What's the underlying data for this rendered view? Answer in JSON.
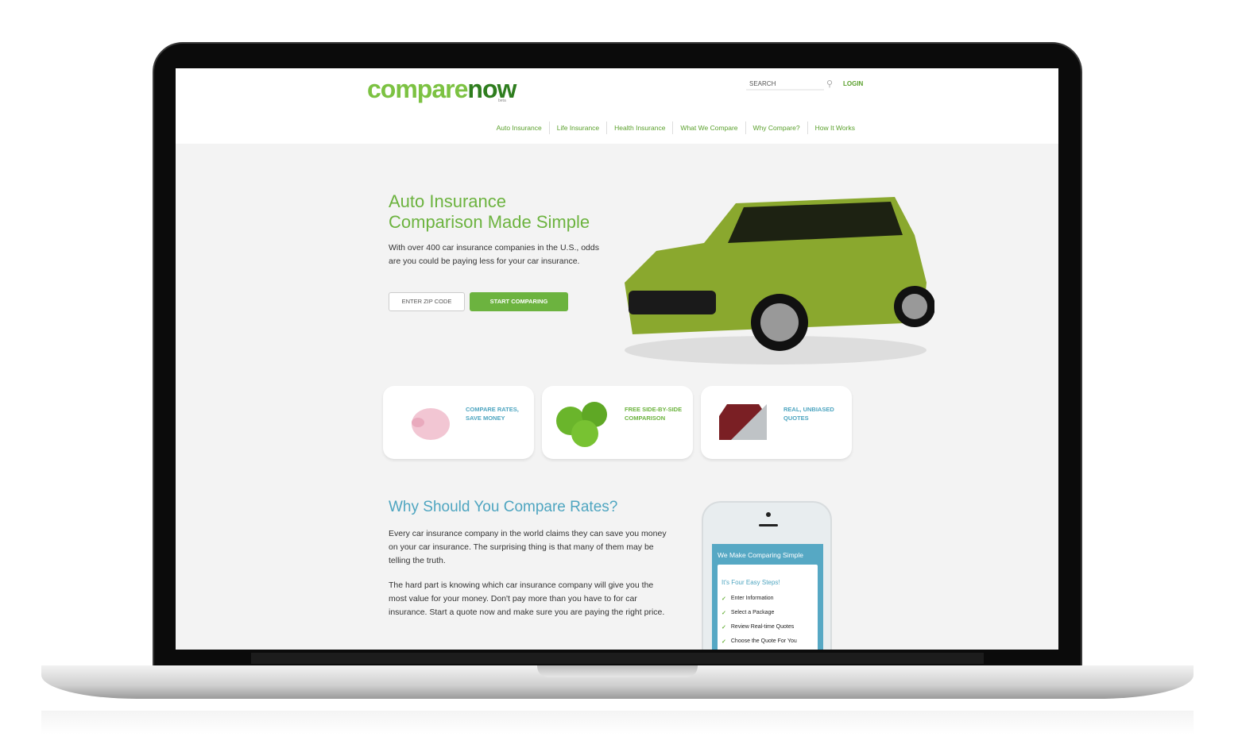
{
  "logo": {
    "text_a": "c",
    "text_o": "o",
    "text_b": "mpare",
    "text_c": "now",
    "beta": "beta"
  },
  "header": {
    "search_placeholder": "SEARCH",
    "login": "LOGIN"
  },
  "nav": [
    "Auto Insurance",
    "Life Insurance",
    "Health Insurance",
    "What We Compare",
    "Why Compare?",
    "How It Works"
  ],
  "hero": {
    "title_line1": "Auto Insurance",
    "title_line2": "Comparison Made Simple",
    "text": "With over 400 car insurance companies in the U.S., odds are you could be paying less for your car insurance.",
    "zip_placeholder": "ENTER ZIP CODE",
    "cta": "START COMPARING"
  },
  "features": [
    {
      "label": "COMPARE RATES, SAVE MONEY",
      "icon": "piggy-bank",
      "color": "#4ea5c0"
    },
    {
      "label": "FREE SIDE-BY-SIDE COMPARISON",
      "icon": "green-apples",
      "color": "#6cb33f"
    },
    {
      "label": "REAL, UNBIASED QUOTES",
      "icon": "split-car",
      "color": "#4ea5c0"
    }
  ],
  "why": {
    "title": "Why Should You Compare Rates?",
    "p1": "Every car insurance company in the world claims they can save you money on your car insurance. The surprising thing is that many of them may be telling the truth.",
    "p2": "The hard part is knowing which car insurance company will give you the most value for your money. Don't pay more than you have to for car insurance. Start a quote now and make sure you are paying the right price."
  },
  "phone": {
    "header": "We Make Comparing Simple",
    "subtitle": "It's Four Easy Steps!",
    "steps": [
      "Enter Information",
      "Select a Package",
      "Review Real-time Quotes",
      "Choose the Quote For You"
    ]
  },
  "colors": {
    "green": "#6cb33f",
    "blue": "#4ea5c0"
  }
}
